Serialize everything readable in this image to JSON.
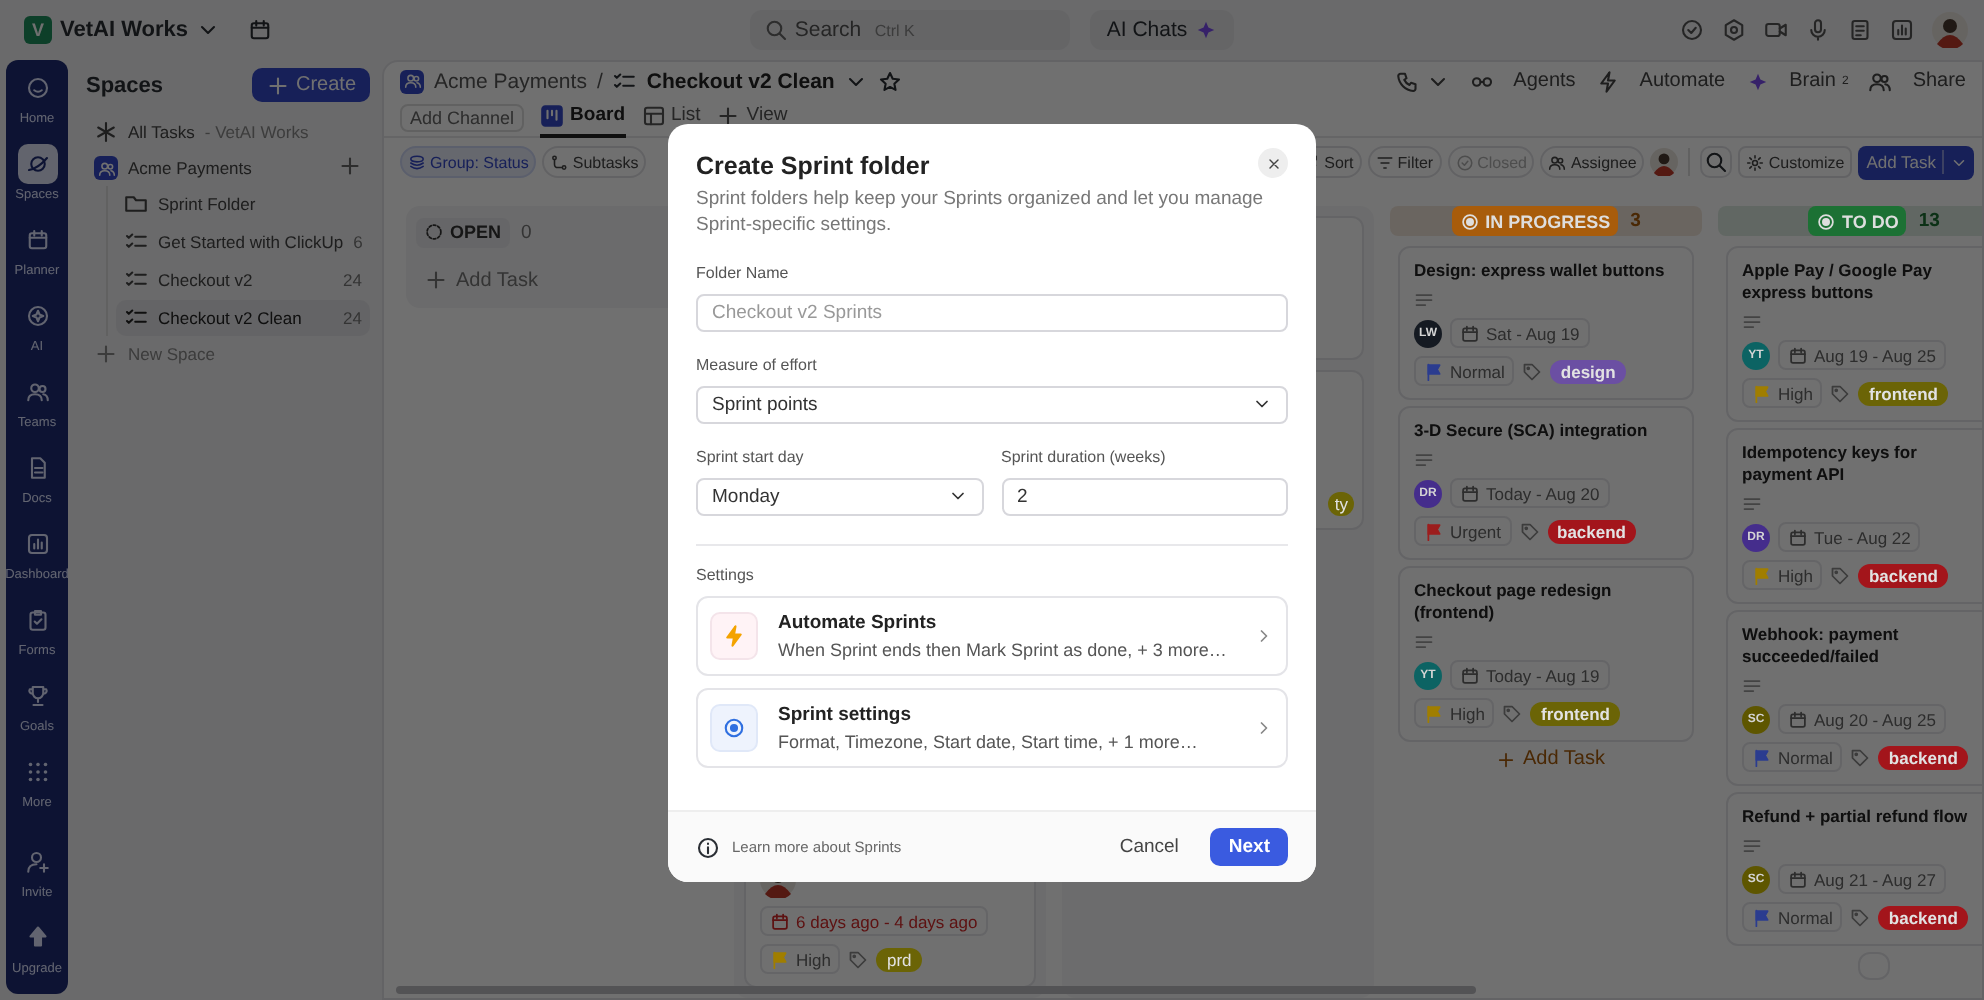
{
  "top_bar": {
    "workspace": {
      "initial": "V",
      "name": "VetAI Works"
    },
    "search": {
      "placeholder": "Search",
      "shortcut": "Ctrl K"
    },
    "ai_chats": "AI Chats"
  },
  "rail": [
    {
      "label": "Home",
      "selected": false
    },
    {
      "label": "Spaces",
      "selected": true
    },
    {
      "label": "Planner",
      "selected": false
    },
    {
      "label": "AI",
      "selected": false
    },
    {
      "label": "Teams",
      "selected": false
    },
    {
      "label": "Docs",
      "selected": false
    },
    {
      "label": "Dashboard",
      "selected": false
    },
    {
      "label": "Forms",
      "selected": false
    },
    {
      "label": "Goals",
      "selected": false
    },
    {
      "label": "More",
      "selected": false
    }
  ],
  "rail_bottom": [
    {
      "label": "Invite"
    },
    {
      "label": "Upgrade"
    }
  ],
  "spaces_panel": {
    "title": "Spaces",
    "create": "Create",
    "all_tasks": {
      "label": "All Tasks",
      "context": "- VetAI Works"
    },
    "spaces": [
      {
        "name": "Acme Payments",
        "children": [
          {
            "name": "Sprint Folder",
            "kind": "folder",
            "selected": false
          },
          {
            "name": "Get Started with ClickUp",
            "kind": "list",
            "count": "6",
            "selected": false
          },
          {
            "name": "Checkout v2",
            "kind": "list",
            "count": "24",
            "selected": false
          },
          {
            "name": "Checkout v2 Clean",
            "kind": "list",
            "count": "24",
            "selected": true
          }
        ]
      }
    ],
    "new_space": "New Space"
  },
  "header": {
    "breadcrumb": [
      "Acme Payments",
      "Checkout v2 Clean"
    ],
    "separator": "/",
    "actions": [
      "Agents",
      "Automate",
      "Brain$^{2}$",
      "Share"
    ]
  },
  "views": {
    "add_channel": "Add Channel",
    "tabs": [
      {
        "label": "Board",
        "selected": true
      },
      {
        "label": "List",
        "selected": false
      }
    ],
    "add_view": "View"
  },
  "toolbar": {
    "group": "Group: Status",
    "subtasks": "Subtasks",
    "sort": "Sort",
    "filter": "Filter",
    "closed": {
      "label": "Closed",
      "disabled": true
    },
    "assignee": "Assignee",
    "customize": "Customize",
    "add_task": "Add Task"
  },
  "board": {
    "columns": [
      {
        "kind": "open",
        "status": "OPEN",
        "count": "0",
        "add_task": "Add Task"
      },
      {
        "kind": "covered",
        "cards": [
          {
            "kind": "task",
            "assignee": {
              "kind": "photo"
            },
            "date": "6 days ago - 4 days ago",
            "overdue": true,
            "priority": {
              "label": "High",
              "color": "#a07e00"
            },
            "tags": [
              {
                "label": "prd",
                "color": "#6b6406"
              }
            ]
          }
        ]
      },
      {
        "kind": "covered",
        "cards": [
          {
            "kind": "hidden"
          },
          {
            "kind": "task",
            "tags": [
              {
                "label": "ty",
                "color": "#6b6406"
              }
            ]
          }
        ]
      },
      {
        "kind": "status",
        "status": "IN PROGRESS",
        "count": "3",
        "color": "#a85c0b",
        "add_task": "Add Task",
        "cards": [
          {
            "kind": "task",
            "title": "Design: express wallet buttons",
            "has_description": true,
            "assignee": {
              "kind": "initials",
              "initials": "LW",
              "color": "#151a22"
            },
            "date": "Sat - Aug 19",
            "overdue": false,
            "priority": {
              "label": "Normal",
              "color": "#2b3c8f"
            },
            "tags": [
              {
                "label": "design",
                "color": "#6b4fa3"
              }
            ]
          },
          {
            "kind": "task",
            "title": "3-D Secure (SCA) integration",
            "has_description": true,
            "assignee": {
              "kind": "initials",
              "initials": "DR",
              "color": "#452d8c"
            },
            "date": "Today - Aug 20",
            "overdue": false,
            "priority": {
              "label": "Urgent",
              "color": "#9c1d1d"
            },
            "tags": [
              {
                "label": "backend",
                "color": "#a3151b"
              }
            ]
          },
          {
            "kind": "task",
            "title": "Checkout page redesign (frontend)",
            "has_description": true,
            "assignee": {
              "kind": "initials",
              "initials": "YT",
              "color": "#0c6363"
            },
            "date": "Today - Aug 19",
            "overdue": false,
            "priority": {
              "label": "High",
              "color": "#a07e00"
            },
            "tags": [
              {
                "label": "frontend",
                "color": "#6b6406"
              }
            ]
          }
        ]
      },
      {
        "kind": "status",
        "status": "TO DO",
        "count": "13",
        "color": "#1c7134",
        "cards": [
          {
            "kind": "task",
            "title": "Apple Pay / Google Pay express buttons",
            "has_description": true,
            "assignee": {
              "kind": "initials",
              "initials": "YT",
              "color": "#0c6363"
            },
            "date": "Aug 19 - Aug 25",
            "overdue": false,
            "priority": {
              "label": "High",
              "color": "#a07e00"
            },
            "tags": [
              {
                "label": "frontend",
                "color": "#6b6406"
              }
            ]
          },
          {
            "kind": "task",
            "title": "Idempotency keys for payment API",
            "has_description": true,
            "assignee": {
              "kind": "initials",
              "initials": "DR",
              "color": "#452d8c"
            },
            "date": "Tue - Aug 22",
            "overdue": false,
            "priority": {
              "label": "High",
              "color": "#a07e00"
            },
            "tags": [
              {
                "label": "backend",
                "color": "#a3151b"
              }
            ]
          },
          {
            "kind": "task",
            "title": "Webhook: payment succeeded/failed",
            "has_description": true,
            "assignee": {
              "kind": "initials",
              "initials": "SC",
              "color": "#5e5600"
            },
            "date": "Aug 20 - Aug 25",
            "overdue": false,
            "priority": {
              "label": "Normal",
              "color": "#2b3c8f"
            },
            "tags": [
              {
                "label": "backend",
                "color": "#a3151b"
              }
            ]
          },
          {
            "kind": "task",
            "title": "Refund + partial refund flow",
            "has_description": true,
            "assignee": {
              "kind": "initials",
              "initials": "SC",
              "color": "#5e5600"
            },
            "date": "Aug 21 - Aug 27",
            "overdue": false,
            "priority": {
              "label": "Normal",
              "color": "#2b3c8f"
            },
            "tags": [
              {
                "label": "backend",
                "color": "#a3151b"
              }
            ]
          },
          {
            "kind": "hidden"
          }
        ]
      }
    ]
  },
  "modal": {
    "title": "Create Sprint folder",
    "description": "Sprint folders help keep your Sprints organized and let you manage Sprint-specific settings.",
    "field_rows": [
      [
        {
          "label": "Folder Name",
          "kind": "text",
          "placeholder": "Checkout v2 Sprints"
        }
      ],
      [
        {
          "label": "Measure of effort",
          "kind": "select",
          "value": "Sprint points"
        }
      ],
      [
        {
          "label": "Sprint start day",
          "kind": "select",
          "value": "Monday"
        },
        {
          "label": "Sprint duration (weeks)",
          "kind": "text",
          "value": "2"
        }
      ]
    ],
    "settings_label": "Settings",
    "settings": [
      {
        "kind": "automation",
        "title": "Automate Sprints",
        "summary": "When Sprint ends then Mark Sprint as done, + 3 more…"
      },
      {
        "kind": "settings",
        "title": "Sprint settings",
        "summary": "Format, Timezone, Start date, Start time, + 1 more…"
      }
    ],
    "learn_more": "Learn more about Sprints",
    "cancel": "Cancel",
    "next": "Next"
  }
}
